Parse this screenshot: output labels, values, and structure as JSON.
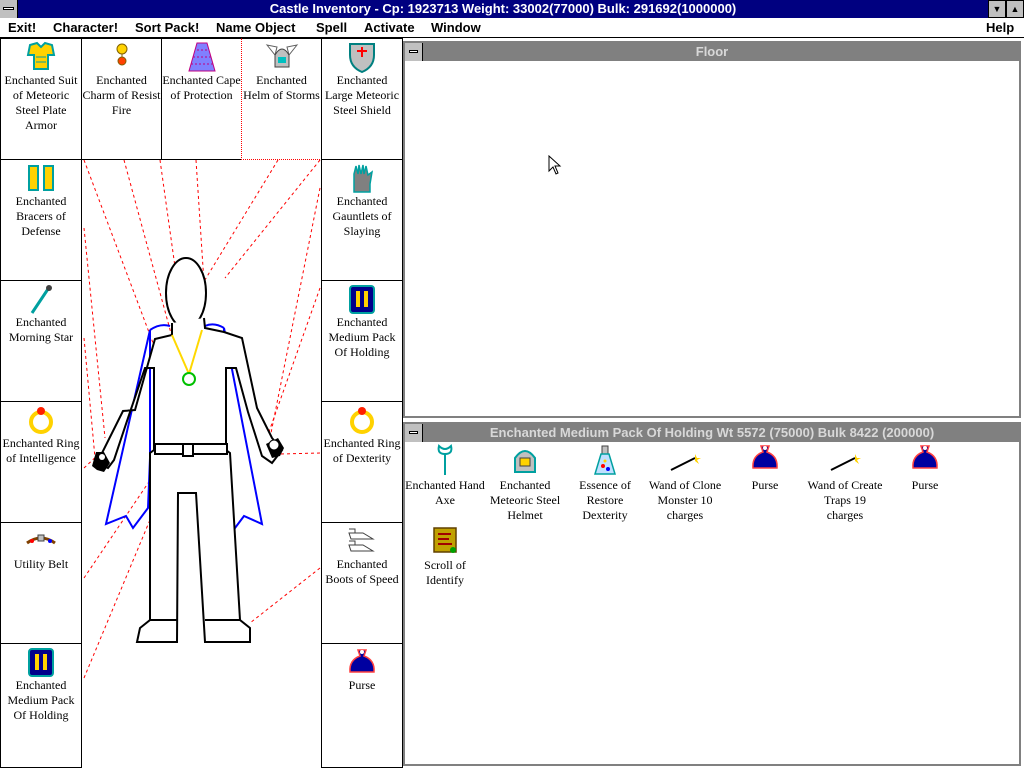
{
  "window": {
    "title": "Castle Inventory - Cp: 1923713 Weight: 33002(77000) Bulk: 291692(1000000)",
    "minimize_glyph": "▼",
    "maximize_glyph": "▲"
  },
  "menu": [
    "Exit!",
    "Character!",
    "Sort Pack!",
    "Name Object",
    "Spell",
    "Activate",
    "Window",
    "Help"
  ],
  "equipment": {
    "top": [
      {
        "label": "Enchanted Suit of Meteoric Steel Plate Armor",
        "icon": "plate-armor-icon"
      },
      {
        "label": "Enchanted Charm of Resist Fire",
        "icon": "charm-icon"
      },
      {
        "label": "Enchanted Cape of Protection",
        "icon": "cape-icon"
      },
      {
        "label": "Enchanted Helm of Storms",
        "icon": "winged-helm-icon"
      },
      {
        "label": "Enchanted Large Meteoric Steel Shield",
        "icon": "shield-icon"
      }
    ],
    "left": [
      {
        "label": "Enchanted Bracers of Defense",
        "icon": "bracers-icon"
      },
      {
        "label": "Enchanted Morning Star",
        "icon": "morning-star-icon"
      },
      {
        "label": "Enchanted Ring of Intelligence",
        "icon": "ring-icon"
      },
      {
        "label": "Utility Belt",
        "icon": "belt-icon"
      },
      {
        "label": "Enchanted Medium Pack Of Holding",
        "icon": "pack-icon"
      }
    ],
    "right": [
      {
        "label": "Enchanted Gauntlets of Slaying",
        "icon": "gauntlet-icon"
      },
      {
        "label": "Enchanted Medium Pack Of Holding",
        "icon": "pack-icon"
      },
      {
        "label": "Enchanted Ring of Dexterity",
        "icon": "ring-icon"
      },
      {
        "label": "Enchanted Boots of Speed",
        "icon": "boots-icon"
      },
      {
        "label": "Purse",
        "icon": "purse-icon"
      }
    ]
  },
  "floor_window": {
    "title": "Floor",
    "items": []
  },
  "pack_window": {
    "title": "Enchanted Medium Pack Of Holding Wt 5572 (75000) Bulk 8422 (200000)",
    "items": [
      {
        "label": "Enchanted Hand Axe",
        "icon": "hand-axe-icon"
      },
      {
        "label": "Enchanted Meteoric Steel Helmet",
        "icon": "helmet-icon"
      },
      {
        "label": "Essence of Restore Dexterity",
        "icon": "potion-icon"
      },
      {
        "label": "Wand of Clone Monster 10 charges",
        "icon": "wand-icon"
      },
      {
        "label": "Purse",
        "icon": "purse-icon"
      },
      {
        "label": "Wand of Create Traps 19 charges",
        "icon": "wand-icon"
      },
      {
        "label": "Purse",
        "icon": "purse-icon"
      },
      {
        "label": "Scroll of Identify",
        "icon": "scroll-icon"
      }
    ]
  },
  "colors": {
    "title_active": "#000080",
    "title_inactive": "#808080",
    "cape": "#0000ff",
    "amulet": "#00c000",
    "chain": "#ffd800",
    "link_lines": "#ff0000"
  }
}
